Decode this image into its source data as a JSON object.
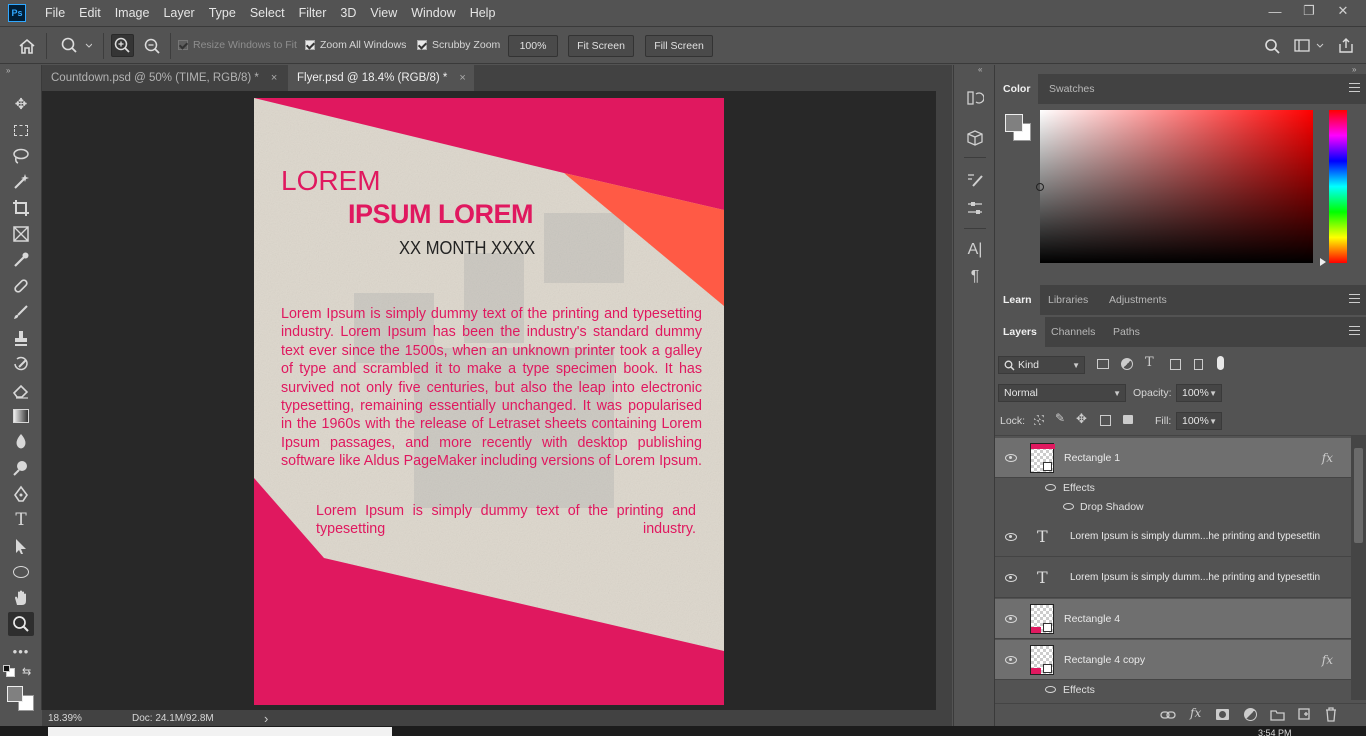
{
  "app": {
    "logo": "Ps"
  },
  "menu": [
    "File",
    "Edit",
    "Image",
    "Layer",
    "Type",
    "Select",
    "Filter",
    "3D",
    "View",
    "Window",
    "Help"
  ],
  "window_controls": {
    "minimize": "—",
    "restore": "❐",
    "close": "✕"
  },
  "options": {
    "resize_windows": "Resize Windows to Fit",
    "zoom_all": "Zoom All Windows",
    "scrubby": "Scrubby Zoom",
    "zoom_value": "100%",
    "fit_screen": "Fit Screen",
    "fill_screen": "Fill Screen"
  },
  "tabs": [
    {
      "label": "Countdown.psd @ 50% (TIME, RGB/8) *",
      "close": "×"
    },
    {
      "label": "Flyer.psd @ 18.4% (RGB/8) *",
      "close": "×"
    }
  ],
  "document": {
    "title1": "LOREM",
    "title2": "IPSUM LOREM",
    "date": "XX MONTH XXXX",
    "body": "Lorem Ipsum is simply dummy text of the printing and typesetting industry. Lorem Ipsum has been the industry's standard dummy text ever since the 1500s, when an unknown printer took a galley of type and scrambled it to make a type specimen book. It has survived not only five centuries, but also the leap into electronic typesetting, remaining essentially unchanged. It was popularised in the 1960s with the release of Letraset sheets containing Lorem Ipsum passages, and more recently with desktop publishing software like Aldus PageMaker including versions of Lorem Ipsum.",
    "body2": "Lorem Ipsum is simply dummy text of the printing and typesetting industry.",
    "colors": {
      "pink": "#e0185f",
      "orange": "#ff5a45",
      "paper": "#ddd7cc"
    }
  },
  "status": {
    "zoom": "18.39%",
    "doc": "Doc: 24.1M/92.8M",
    "arrow": "›"
  },
  "color_panel": {
    "tabs": [
      "Color",
      "Swatches"
    ]
  },
  "learn_panel": {
    "tabs": [
      "Learn",
      "Libraries",
      "Adjustments"
    ]
  },
  "layers_panel": {
    "tabs": [
      "Layers",
      "Channels",
      "Paths"
    ],
    "kind": "Kind",
    "blend": "Normal",
    "opacity_label": "Opacity:",
    "opacity": "100%",
    "lock_label": "Lock:",
    "fill_label": "Fill:",
    "fill": "100%",
    "layers": [
      {
        "name": "Rectangle 1",
        "type": "shape",
        "fx": "fx"
      },
      {
        "name": "Lorem Ipsum is simply dumm...he printing and typesettin",
        "type": "text",
        "glyph": "T"
      },
      {
        "name": "Lorem Ipsum is simply dumm...he printing and typesettin",
        "type": "text",
        "glyph": "T"
      },
      {
        "name": "Rectangle 4",
        "type": "shape"
      },
      {
        "name": "Rectangle 4 copy",
        "type": "shape",
        "fx": "fx"
      }
    ],
    "effects_label": "Effects",
    "drop_shadow": "Drop Shadow"
  },
  "clock": "3:54 PM"
}
